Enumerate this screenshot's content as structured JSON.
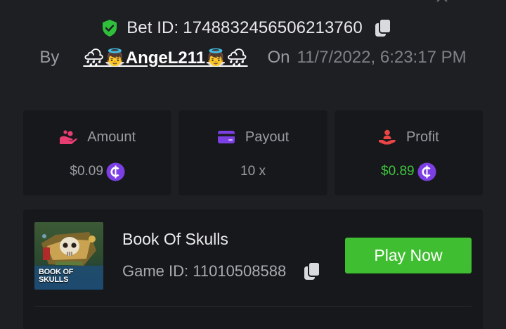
{
  "header": {
    "corner_icon": "expand-arrow-icon",
    "bet_label": "Bet ID:",
    "bet_id": "1748832456506213760",
    "shield_icon": "verified-shield-icon",
    "copy_icon": "copy-icon",
    "by_label": "By",
    "username": "🌧👼AngeL211👼🌧",
    "on_label": "On",
    "date": "11/7/2022, 6:23:17 PM"
  },
  "stats": [
    {
      "label": "Amount",
      "value": "$0.09",
      "icon": "hand-coins-icon",
      "icon_color": "#e83d73"
    },
    {
      "label": "Payout",
      "value": "10 x",
      "icon": "wallet-card-icon",
      "icon_color": "#7b3fe4"
    },
    {
      "label": "Profit",
      "value": "$0.89",
      "icon": "hand-person-icon",
      "icon_color": "#e84545"
    }
  ],
  "coin_icon": "cent-coin-icon",
  "colors": {
    "background": "#1e1f23",
    "card": "#17181b",
    "accent_green": "#40be31",
    "profit_green": "#3fc43f",
    "shield_green": "#2fbf3a",
    "coin_purple": "#7b3fe4"
  },
  "game": {
    "thumbnail_title": "BOOK OF SKULLS",
    "title": "Book Of Skulls",
    "id_label": "Game ID:",
    "id": "11010508588",
    "play_label": "Play Now"
  }
}
